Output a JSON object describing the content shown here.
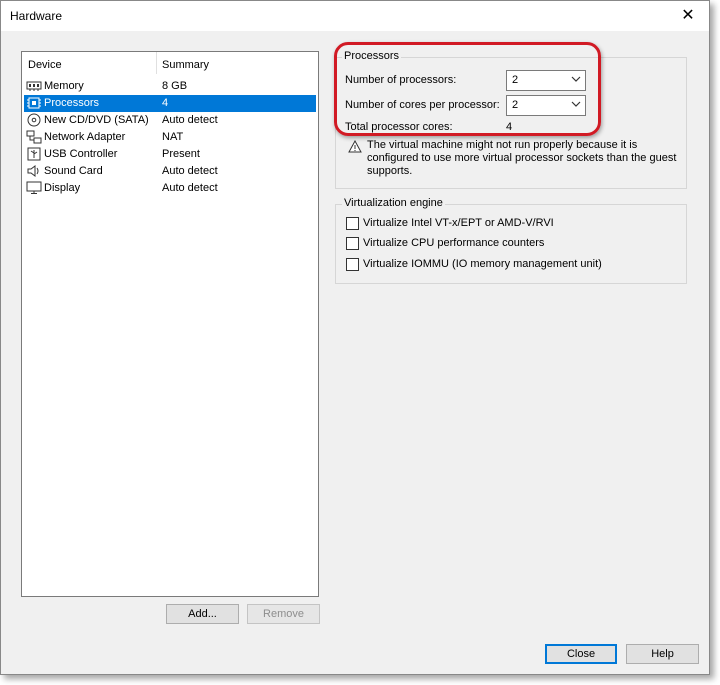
{
  "window": {
    "title": "Hardware"
  },
  "device_list": {
    "headers": {
      "device": "Device",
      "summary": "Summary"
    },
    "items": [
      {
        "icon": "memory-icon",
        "label": "Memory",
        "summary": "8 GB"
      },
      {
        "icon": "processor-icon",
        "label": "Processors",
        "summary": "4",
        "selected": true
      },
      {
        "icon": "cd-dvd-icon",
        "label": "New CD/DVD (SATA)",
        "summary": "Auto detect"
      },
      {
        "icon": "network-adapter-icon",
        "label": "Network Adapter",
        "summary": "NAT"
      },
      {
        "icon": "usb-icon",
        "label": "USB Controller",
        "summary": "Present"
      },
      {
        "icon": "speaker-icon",
        "label": "Sound Card",
        "summary": "Auto detect"
      },
      {
        "icon": "display-icon",
        "label": "Display",
        "summary": "Auto detect"
      }
    ],
    "add_label": "Add...",
    "remove_label": "Remove"
  },
  "processors": {
    "group_label": "Processors",
    "num_processors_label": "Number of processors:",
    "num_processors_value": "2",
    "cores_label": "Number of cores per processor:",
    "cores_value": "2",
    "total_label": "Total processor cores:",
    "total_value": "4",
    "warning": "The virtual machine might not run properly because it is configured to use more virtual processor sockets than the guest supports."
  },
  "virtualization": {
    "group_label": "Virtualization engine",
    "options": [
      {
        "label": "Virtualize Intel VT-x/EPT or AMD-V/RVI",
        "checked": false
      },
      {
        "label": "Virtualize CPU performance counters",
        "checked": false
      },
      {
        "label": "Virtualize IOMMU (IO memory management unit)",
        "checked": false
      }
    ]
  },
  "footer": {
    "close_label": "Close",
    "help_label": "Help"
  },
  "colors": {
    "selection": "#0078d7",
    "highlight": "#d11a24",
    "warning": "#f0c000"
  }
}
